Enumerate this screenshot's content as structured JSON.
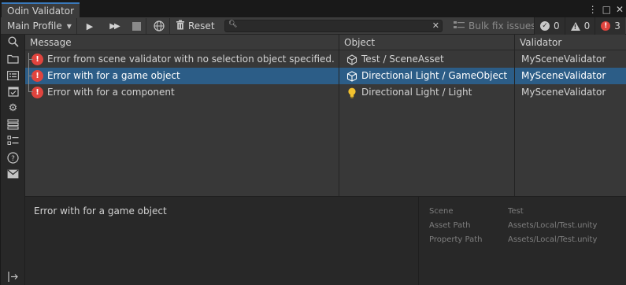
{
  "window": {
    "tab_title": "Odin Validator",
    "controls": [
      "⋮",
      "□",
      "✕"
    ]
  },
  "toolbar": {
    "profile": "Main Profile",
    "reset_label": "Reset",
    "search_value": "",
    "bulk_fix_label": "Bulk fix issues",
    "counts": {
      "valid": "0",
      "warnings": "0",
      "errors": "3"
    }
  },
  "sidebar": {
    "icons": [
      "search-icon",
      "folder-icon",
      "list-icon",
      "calendar-check-icon",
      "gear-icon",
      "layers-icon",
      "checklist-icon",
      "help-icon",
      "mail-icon",
      "exit-icon"
    ]
  },
  "table": {
    "headers": {
      "message": "Message",
      "object": "Object",
      "validator": "Validator"
    },
    "rows": [
      {
        "message": "Error from scene validator with no selection object specified.",
        "object": "Test / SceneAsset",
        "object_icon": "unity-icon",
        "validator": "MySceneValidator",
        "selected": false
      },
      {
        "message": "Error with for a game object",
        "object": "Directional Light / GameObject",
        "object_icon": "cube-icon",
        "validator": "MySceneValidator",
        "selected": true
      },
      {
        "message": "Error with for a component",
        "object": "Directional Light / Light",
        "object_icon": "light-bulb-icon",
        "validator": "MySceneValidator",
        "selected": false
      }
    ]
  },
  "details": {
    "message": "Error with for a game object",
    "properties": [
      {
        "label": "Scene",
        "value": "Test"
      },
      {
        "label": "Asset Path",
        "value": "Assets/Local/Test.unity"
      },
      {
        "label": "Property Path",
        "value": "Assets/Local/Test.unity"
      }
    ]
  },
  "colors": {
    "accent": "#3a79bb",
    "selection": "#2c5d87",
    "error": "#e0443e"
  }
}
